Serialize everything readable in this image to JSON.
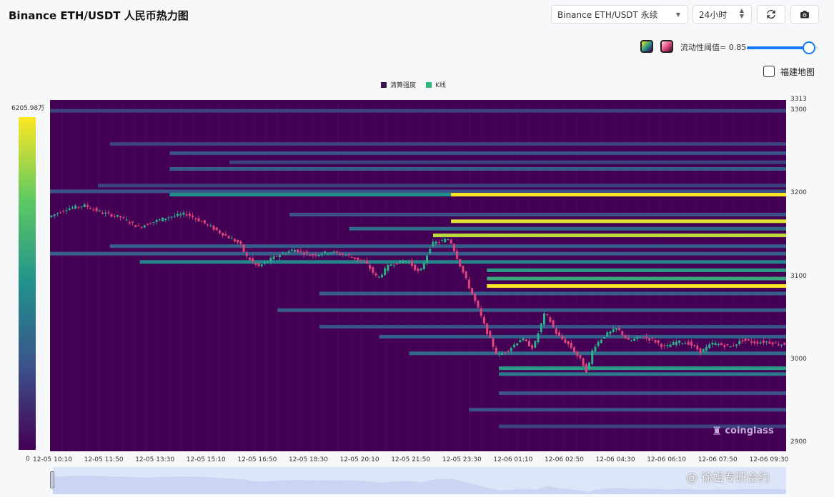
{
  "header": {
    "title": "Binance ETH/USDT 人民币热力图",
    "market_select": "Binance ETH/USDT 永续",
    "period_select": "24小时",
    "refresh_icon": "refresh-icon",
    "camera_icon": "camera-icon"
  },
  "controls": {
    "threshold_label": "流动性阈值= 0.85",
    "threshold_value": 0.85,
    "palette_a_icon": "viridis-palette-icon",
    "palette_b_icon": "pink-palette-icon",
    "map_checkbox_label": "福建地图",
    "map_checkbox_checked": false
  },
  "colors": {
    "accent": "#1677ff",
    "heat_bg": "#440154",
    "candle_up": "#29b38a",
    "candle_down": "#e0457b"
  },
  "legend": {
    "liquidation": "清算强度",
    "kline": "K线"
  },
  "colorbar": {
    "max": "6205.98万",
    "min": "0"
  },
  "watermark": "coinglass",
  "watermark2": "@ 徐姐专研合约",
  "chart_data": {
    "type": "heatmap",
    "ylim": [
      2890,
      3313
    ],
    "yticks": [
      "3313",
      "3300",
      "3200",
      "3100",
      "3000",
      "2900"
    ],
    "xticks": [
      "12-05 10:10",
      "12-05 11:50",
      "12-05 13:30",
      "12-05 15:10",
      "12-05 16:50",
      "12-05 18:30",
      "12-05 20:10",
      "12-05 21:50",
      "12-05 23:30",
      "12-06 01:10",
      "12-06 02:50",
      "12-06 04:30",
      "12-06 06:10",
      "12-06 07:50",
      "12-06 09:30"
    ],
    "price_path": [
      [
        0,
        3172
      ],
      [
        3,
        3182
      ],
      [
        6,
        3186
      ],
      [
        9,
        3177
      ],
      [
        12,
        3172
      ],
      [
        15,
        3160
      ],
      [
        17,
        3165
      ],
      [
        20,
        3172
      ],
      [
        23,
        3176
      ],
      [
        26,
        3165
      ],
      [
        29,
        3152
      ],
      [
        32,
        3140
      ],
      [
        33,
        3125
      ],
      [
        35,
        3112
      ],
      [
        38,
        3125
      ],
      [
        41,
        3133
      ],
      [
        44,
        3126
      ],
      [
        47,
        3130
      ],
      [
        50,
        3126
      ],
      [
        53,
        3117
      ],
      [
        55,
        3098
      ],
      [
        57,
        3115
      ],
      [
        60,
        3120
      ],
      [
        62,
        3104
      ],
      [
        64,
        3140
      ],
      [
        67,
        3146
      ],
      [
        69,
        3110
      ],
      [
        72,
        3058
      ],
      [
        73,
        3038
      ],
      [
        75,
        3005
      ],
      [
        77,
        3013
      ],
      [
        79,
        3026
      ],
      [
        81,
        3014
      ],
      [
        83,
        3058
      ],
      [
        85,
        3030
      ],
      [
        87,
        3018
      ],
      [
        89,
        2999
      ],
      [
        90,
        2985
      ],
      [
        91,
        3015
      ],
      [
        93,
        3030
      ],
      [
        95,
        3038
      ],
      [
        97,
        3022
      ],
      [
        99,
        3028
      ],
      [
        101,
        3024
      ],
      [
        103,
        3015
      ],
      [
        105,
        3022
      ],
      [
        107,
        3020
      ],
      [
        109,
        3010
      ],
      [
        111,
        3020
      ],
      [
        114,
        3016
      ],
      [
        116,
        3024
      ],
      [
        118,
        3021
      ],
      [
        120,
        3022
      ],
      [
        122,
        3019
      ]
    ],
    "bands": [
      {
        "price": 3300,
        "x0": 0,
        "x1": 123,
        "level": 0.2
      },
      {
        "price": 3260,
        "x0": 10,
        "x1": 123,
        "level": 0.2
      },
      {
        "price": 3249,
        "x0": 20,
        "x1": 123,
        "level": 0.25
      },
      {
        "price": 3238,
        "x0": 30,
        "x1": 123,
        "level": 0.2
      },
      {
        "price": 3230,
        "x0": 20,
        "x1": 123,
        "level": 0.3
      },
      {
        "price": 3210,
        "x0": 8,
        "x1": 123,
        "level": 0.2
      },
      {
        "price": 3203,
        "x0": 0,
        "x1": 123,
        "level": 0.25
      },
      {
        "price": 3199,
        "x0": 20,
        "x1": 67,
        "level": 0.5
      },
      {
        "price": 3199,
        "x0": 67,
        "x1": 123,
        "level": 1.0
      },
      {
        "price": 3175,
        "x0": 40,
        "x1": 123,
        "level": 0.25
      },
      {
        "price": 3167,
        "x0": 67,
        "x1": 123,
        "level": 0.95
      },
      {
        "price": 3158,
        "x0": 50,
        "x1": 123,
        "level": 0.35
      },
      {
        "price": 3150,
        "x0": 64,
        "x1": 123,
        "level": 0.9
      },
      {
        "price": 3137,
        "x0": 10,
        "x1": 123,
        "level": 0.3
      },
      {
        "price": 3128,
        "x0": 0,
        "x1": 123,
        "level": 0.3
      },
      {
        "price": 3118,
        "x0": 15,
        "x1": 123,
        "level": 0.45
      },
      {
        "price": 3108,
        "x0": 73,
        "x1": 123,
        "level": 0.55
      },
      {
        "price": 3098,
        "x0": 73,
        "x1": 123,
        "level": 0.6
      },
      {
        "price": 3089,
        "x0": 73,
        "x1": 123,
        "level": 1.0
      },
      {
        "price": 3080,
        "x0": 45,
        "x1": 123,
        "level": 0.3
      },
      {
        "price": 3060,
        "x0": 38,
        "x1": 123,
        "level": 0.3
      },
      {
        "price": 3040,
        "x0": 45,
        "x1": 123,
        "level": 0.25
      },
      {
        "price": 3028,
        "x0": 55,
        "x1": 123,
        "level": 0.3
      },
      {
        "price": 3008,
        "x0": 60,
        "x1": 123,
        "level": 0.35
      },
      {
        "price": 2990,
        "x0": 75,
        "x1": 123,
        "level": 0.55
      },
      {
        "price": 2983,
        "x0": 75,
        "x1": 123,
        "level": 0.4
      },
      {
        "price": 2960,
        "x0": 75,
        "x1": 123,
        "level": 0.25
      },
      {
        "price": 2940,
        "x0": 70,
        "x1": 123,
        "level": 0.25
      },
      {
        "price": 2920,
        "x0": 75,
        "x1": 123,
        "level": 0.2
      }
    ]
  }
}
